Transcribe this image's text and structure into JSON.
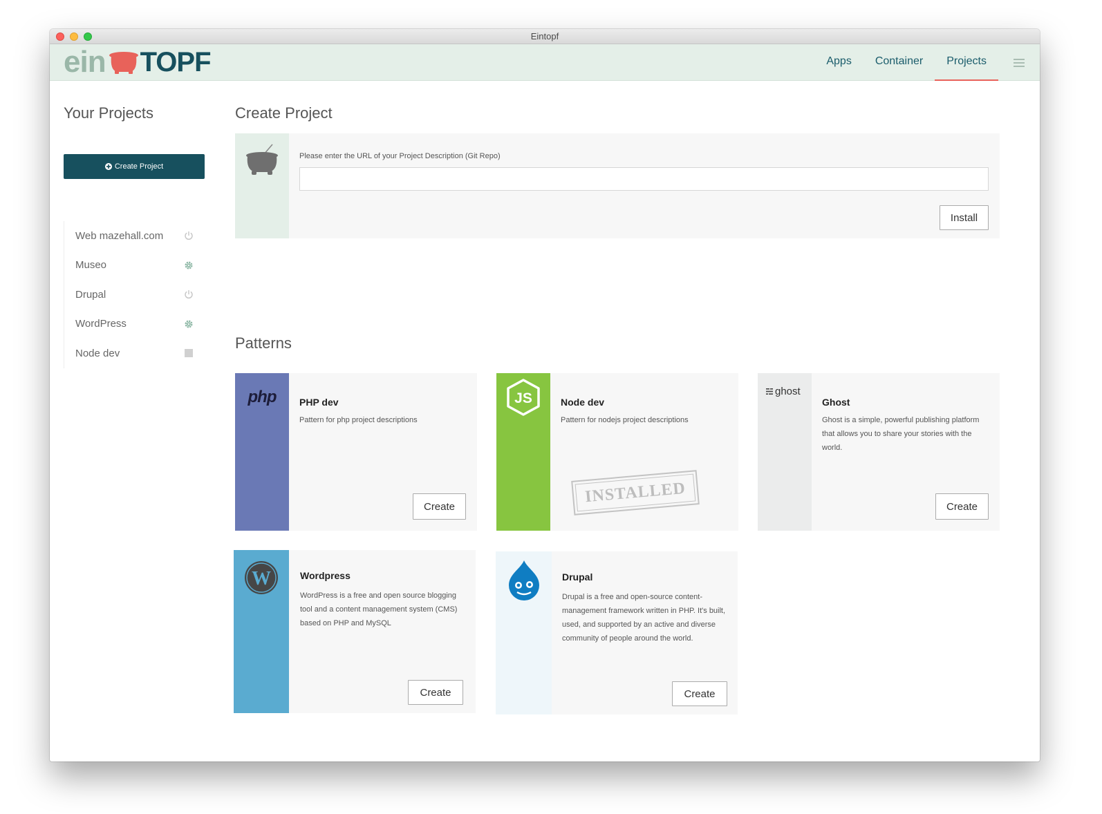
{
  "window": {
    "title": "Eintopf"
  },
  "logo": {
    "part1": "ein",
    "part2": "TOPF"
  },
  "nav": {
    "items": [
      {
        "label": "Apps",
        "active": false
      },
      {
        "label": "Container",
        "active": false
      },
      {
        "label": "Projects",
        "active": true
      }
    ],
    "menu_icon": "hamburger-icon"
  },
  "sidebar": {
    "title": "Your Projects",
    "create_button": "Create Project",
    "projects": [
      {
        "name": "Web mazehall.com",
        "status_icon": "power-icon"
      },
      {
        "name": "Museo",
        "status_icon": "gear-icon"
      },
      {
        "name": "Drupal",
        "status_icon": "power-icon"
      },
      {
        "name": "WordPress",
        "status_icon": "gear-icon"
      },
      {
        "name": "Node dev",
        "status_icon": "stop-icon"
      }
    ]
  },
  "create_project": {
    "title": "Create Project",
    "url_label": "Please enter the URL of your Project Description (Git Repo)",
    "url_value": "",
    "install_button": "Install"
  },
  "patterns": {
    "title": "Patterns",
    "items": [
      {
        "name": "PHP dev",
        "description": "Pattern for php project descriptions",
        "logo_text": "php",
        "button": "Create"
      },
      {
        "name": "Node dev",
        "description": "Pattern for nodejs project descriptions",
        "logo_text": "JS",
        "stamp": "INSTALLED"
      },
      {
        "name": "Ghost",
        "description": "Ghost is a simple, powerful publishing platform that allows you to share your stories with the world.",
        "logo_text": "ghost",
        "button": "Create"
      },
      {
        "name": "Wordpress",
        "description": "WordPress is a free and open source blogging tool and a content management system (CMS) based on PHP and MySQL",
        "logo_text": "W",
        "button": "Create"
      },
      {
        "name": "Drupal",
        "description": "Drupal is a free and open-source content-management framework written in PHP. It's built, used, and supported by an active and diverse community of people around the world.",
        "button": "Create"
      }
    ]
  },
  "colors": {
    "brand_dark": "#17505e",
    "brand_light": "#9ab7a8",
    "pot_red": "#e8625a",
    "navbar_bg": "#e4efe8",
    "php_stripe": "#6a79b5",
    "node_stripe": "#87c540",
    "ghost_stripe": "#ebecec",
    "wordpress_stripe": "#5aabd0",
    "drupal_stripe": "#eef6fa"
  }
}
